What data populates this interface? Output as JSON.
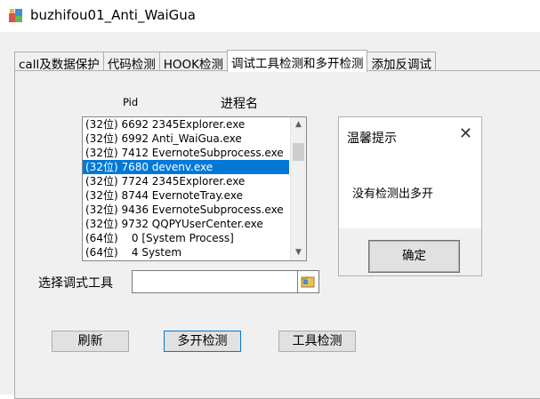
{
  "window": {
    "title": "buzhifou01_Anti_WaiGua"
  },
  "tabs": [
    {
      "label": "call及数据保护"
    },
    {
      "label": "代码检测"
    },
    {
      "label": "HOOK检测"
    },
    {
      "label": "调试工具检测和多开检测"
    },
    {
      "label": "添加反调试"
    }
  ],
  "active_tab": 3,
  "columns": {
    "pid": "Pid",
    "name": "进程名"
  },
  "process_list": [
    "(32位) 6692 2345Explorer.exe",
    "(32位) 6992 Anti_WaiGua.exe",
    "(32位) 7412 EvernoteSubprocess.exe",
    "(32位) 7680 devenv.exe",
    "(32位) 7724 2345Explorer.exe",
    "(32位) 8744 EvernoteTray.exe",
    "(32位) 9436 EvernoteSubprocess.exe",
    "(32位) 9732 QQPYUserCenter.exe",
    "(64位)    0 [System Process]",
    "(64位)    4 System"
  ],
  "selected_index": 3,
  "dialog": {
    "title": "温馨提示",
    "message": "没有检测出多开",
    "ok_label": "确定"
  },
  "select_tool": {
    "label": "选择调式工具",
    "value": ""
  },
  "buttons": {
    "refresh": "刷新",
    "multi_open": "多开检测",
    "tool_detect": "工具检测"
  },
  "colors": {
    "selection": "#0078d7",
    "client_bg": "#f0f0f0"
  }
}
